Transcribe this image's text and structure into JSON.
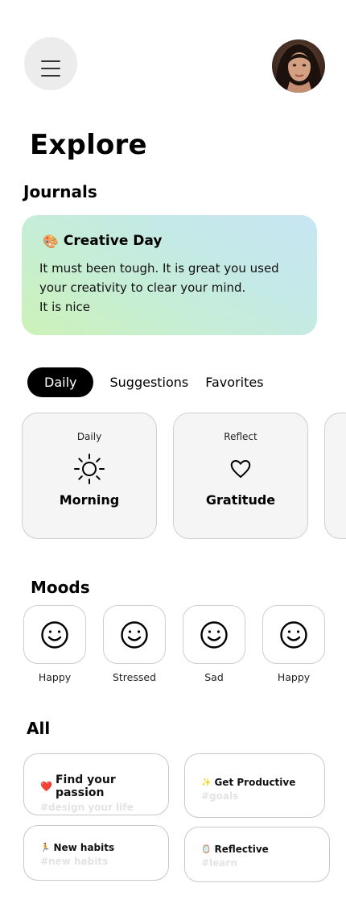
{
  "header": {
    "menu_icon": "hamburger-menu-icon",
    "avatar_icon": "profile-avatar"
  },
  "page_title": "Explore",
  "journals": {
    "heading": "Journals",
    "card": {
      "emoji": "🎨",
      "title": "Creative Day",
      "text": "It must been tough. It is great you  used your creativity to clear your mind.\nIt is nice"
    }
  },
  "tabs": [
    {
      "label": "Daily",
      "active": true
    },
    {
      "label": "Suggestions",
      "active": false
    },
    {
      "label": "Favorites",
      "active": false
    }
  ],
  "daily_cards": [
    {
      "category": "Daily",
      "icon": "sun-icon",
      "name": "Morning"
    },
    {
      "category": "Reflect",
      "icon": "heart-icon",
      "name": "Gratitude"
    }
  ],
  "moods": {
    "heading": "Moods",
    "items": [
      {
        "label": "Happy",
        "icon": "smiley-icon"
      },
      {
        "label": "Stressed",
        "icon": "smiley-icon"
      },
      {
        "label": "Sad",
        "icon": "smiley-icon"
      },
      {
        "label": "Happy",
        "icon": "smiley-icon"
      }
    ]
  },
  "all": {
    "heading": "All",
    "items": [
      {
        "emoji": "❤️",
        "title": "Find your passion",
        "tag": "#design your life"
      },
      {
        "emoji": "✨",
        "title": "Get Productive",
        "tag": "#goals"
      },
      {
        "emoji": "🏃",
        "title": "New habits",
        "tag": "#new habits"
      },
      {
        "emoji": "🪞",
        "title": "Reflective",
        "tag": "#learn"
      }
    ]
  },
  "colors": {
    "accent": "#000000",
    "journal_gradient_start": "#cdf2b8",
    "journal_gradient_end": "#c8e6f3",
    "card_bg": "#f5f5f5",
    "tag_text": "#e3e3e3"
  }
}
